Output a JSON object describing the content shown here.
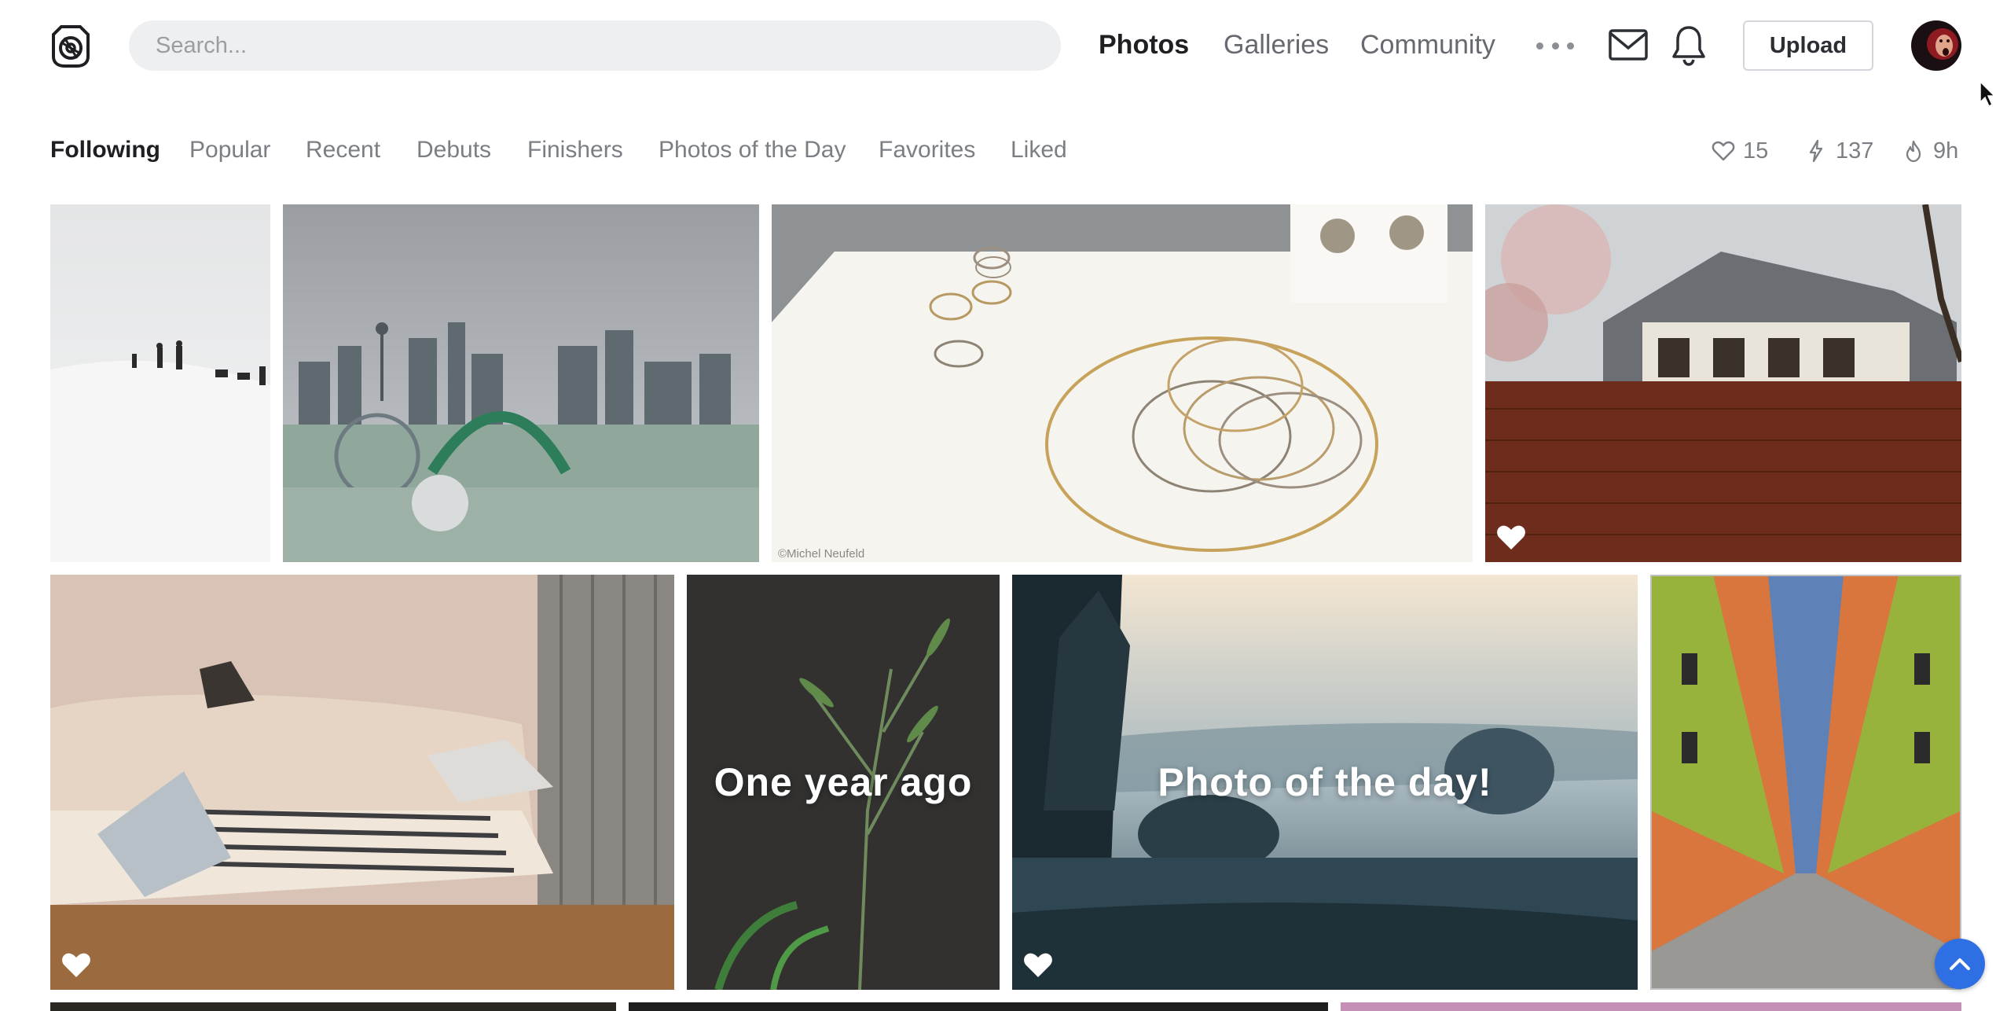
{
  "header": {
    "search_placeholder": "Search...",
    "nav": [
      "Photos",
      "Galleries",
      "Community"
    ],
    "upload_label": "Upload"
  },
  "subnav": {
    "tabs": [
      "Following",
      "Popular",
      "Recent",
      "Debuts",
      "Finishers",
      "Photos of the Day",
      "Favorites",
      "Liked"
    ],
    "active_tab": "Following"
  },
  "stats": {
    "likes": "15",
    "pulse": "137",
    "time": "9h"
  },
  "photos": {
    "watermark": "©Michel Neufeld",
    "one_year_ago": "One year ago",
    "photo_of_day": "Photo of the day!"
  },
  "icons": {
    "logo": "500px-logo-icon",
    "mail": "mail-icon",
    "bell": "bell-icon",
    "heart": "heart-icon",
    "bolt": "bolt-icon",
    "flame": "flame-icon",
    "scroll_top": "chevron-up-icon"
  },
  "colors": {
    "accent_blue": "#2f6fe4",
    "text_dark": "#1d1f22",
    "text_muted": "#7b7f84"
  }
}
